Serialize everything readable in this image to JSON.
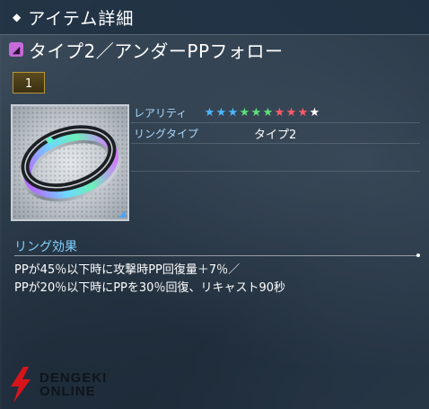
{
  "header": {
    "title": "アイテム詳細",
    "bullet_icon": "diamond-bullet-icon"
  },
  "item": {
    "type_icon": "ring-tag-icon",
    "name": "タイプ2／アンダーPPフォロー",
    "quantity": "1"
  },
  "stats": {
    "rarity_label": "レアリティ",
    "rarity_stars": 10,
    "star_colors": [
      "#4bb6ff",
      "#4bb6ff",
      "#4bb6ff",
      "#5ee07a",
      "#5ee07a",
      "#5ee07a",
      "#ff5a6a",
      "#ff5a6a",
      "#ff5a6a",
      "#ffffff"
    ],
    "ring_type_label": "リングタイプ",
    "ring_type_value": "タイプ2"
  },
  "effect": {
    "title": "リング効果",
    "line1": "PPが45％以下時に攻撃時PP回復量＋7％／",
    "line2": "PPが20％以下時にPPを30％回復、リキャスト90秒"
  },
  "watermark": {
    "line1": "DENGEKI",
    "line2": "ONLINE",
    "logo_icon": "dengeki-logo-icon"
  }
}
